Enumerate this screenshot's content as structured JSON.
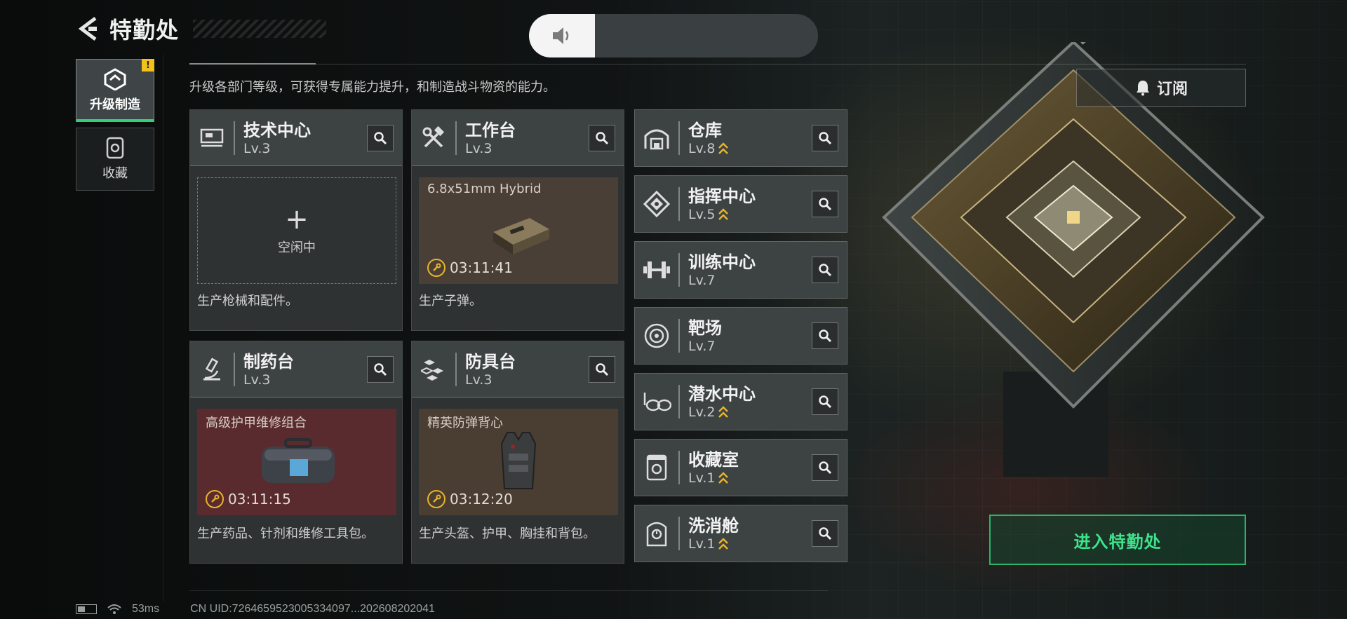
{
  "header": {
    "title": "特勤处"
  },
  "sidebar": {
    "tabs": [
      {
        "label": "升级制造",
        "active": true,
        "badge": "!"
      },
      {
        "label": "收藏",
        "active": false
      }
    ]
  },
  "description": "升级各部门等级，可获得专属能力提升，和制造战斗物资的能力。",
  "subscribe_label": "订阅",
  "enter_label": "进入特勤处",
  "production_cards": [
    {
      "name": "技术中心",
      "level": "Lv.3",
      "slot": {
        "state": "idle",
        "label": "空闲中"
      },
      "footer": "生产枪械和配件。"
    },
    {
      "name": "工作台",
      "level": "Lv.3",
      "slot": {
        "state": "producing",
        "item": "6.8x51mm Hybrid",
        "timer": "03:11:41",
        "bg": "#4a3f37"
      },
      "footer": "生产子弹。"
    },
    {
      "name": "制药台",
      "level": "Lv.3",
      "slot": {
        "state": "producing",
        "item": "高级护甲维修组合",
        "timer": "03:11:15",
        "bg": "#5a2b2e"
      },
      "footer": "生产药品、针剂和维修工具包。"
    },
    {
      "name": "防具台",
      "level": "Lv.3",
      "slot": {
        "state": "producing",
        "item": "精英防弹背心",
        "timer": "03:12:20",
        "bg": "#4a3d32"
      },
      "footer": "生产头盔、护甲、胸挂和背包。"
    }
  ],
  "departments": [
    {
      "name": "仓库",
      "level": "Lv.8",
      "upgradable": true,
      "icon": "warehouse-icon"
    },
    {
      "name": "指挥中心",
      "level": "Lv.5",
      "upgradable": true,
      "icon": "command-icon"
    },
    {
      "name": "训练中心",
      "level": "Lv.7",
      "upgradable": false,
      "icon": "dumbbell-icon"
    },
    {
      "name": "靶场",
      "level": "Lv.7",
      "upgradable": false,
      "icon": "target-icon"
    },
    {
      "name": "潜水中心",
      "level": "Lv.2",
      "upgradable": true,
      "icon": "goggles-icon"
    },
    {
      "name": "收藏室",
      "level": "Lv.1",
      "upgradable": true,
      "icon": "collection-icon"
    },
    {
      "name": "洗消舱",
      "level": "Lv.1",
      "upgradable": true,
      "icon": "decon-icon"
    }
  ],
  "status": {
    "ping": "53ms",
    "uid": "CN UID:7264659523005334097...202608202041"
  },
  "colors": {
    "accent_green": "#2fd17a",
    "timer_yellow": "#e7b42a",
    "upgrade_chevron": "#e7b42a"
  }
}
